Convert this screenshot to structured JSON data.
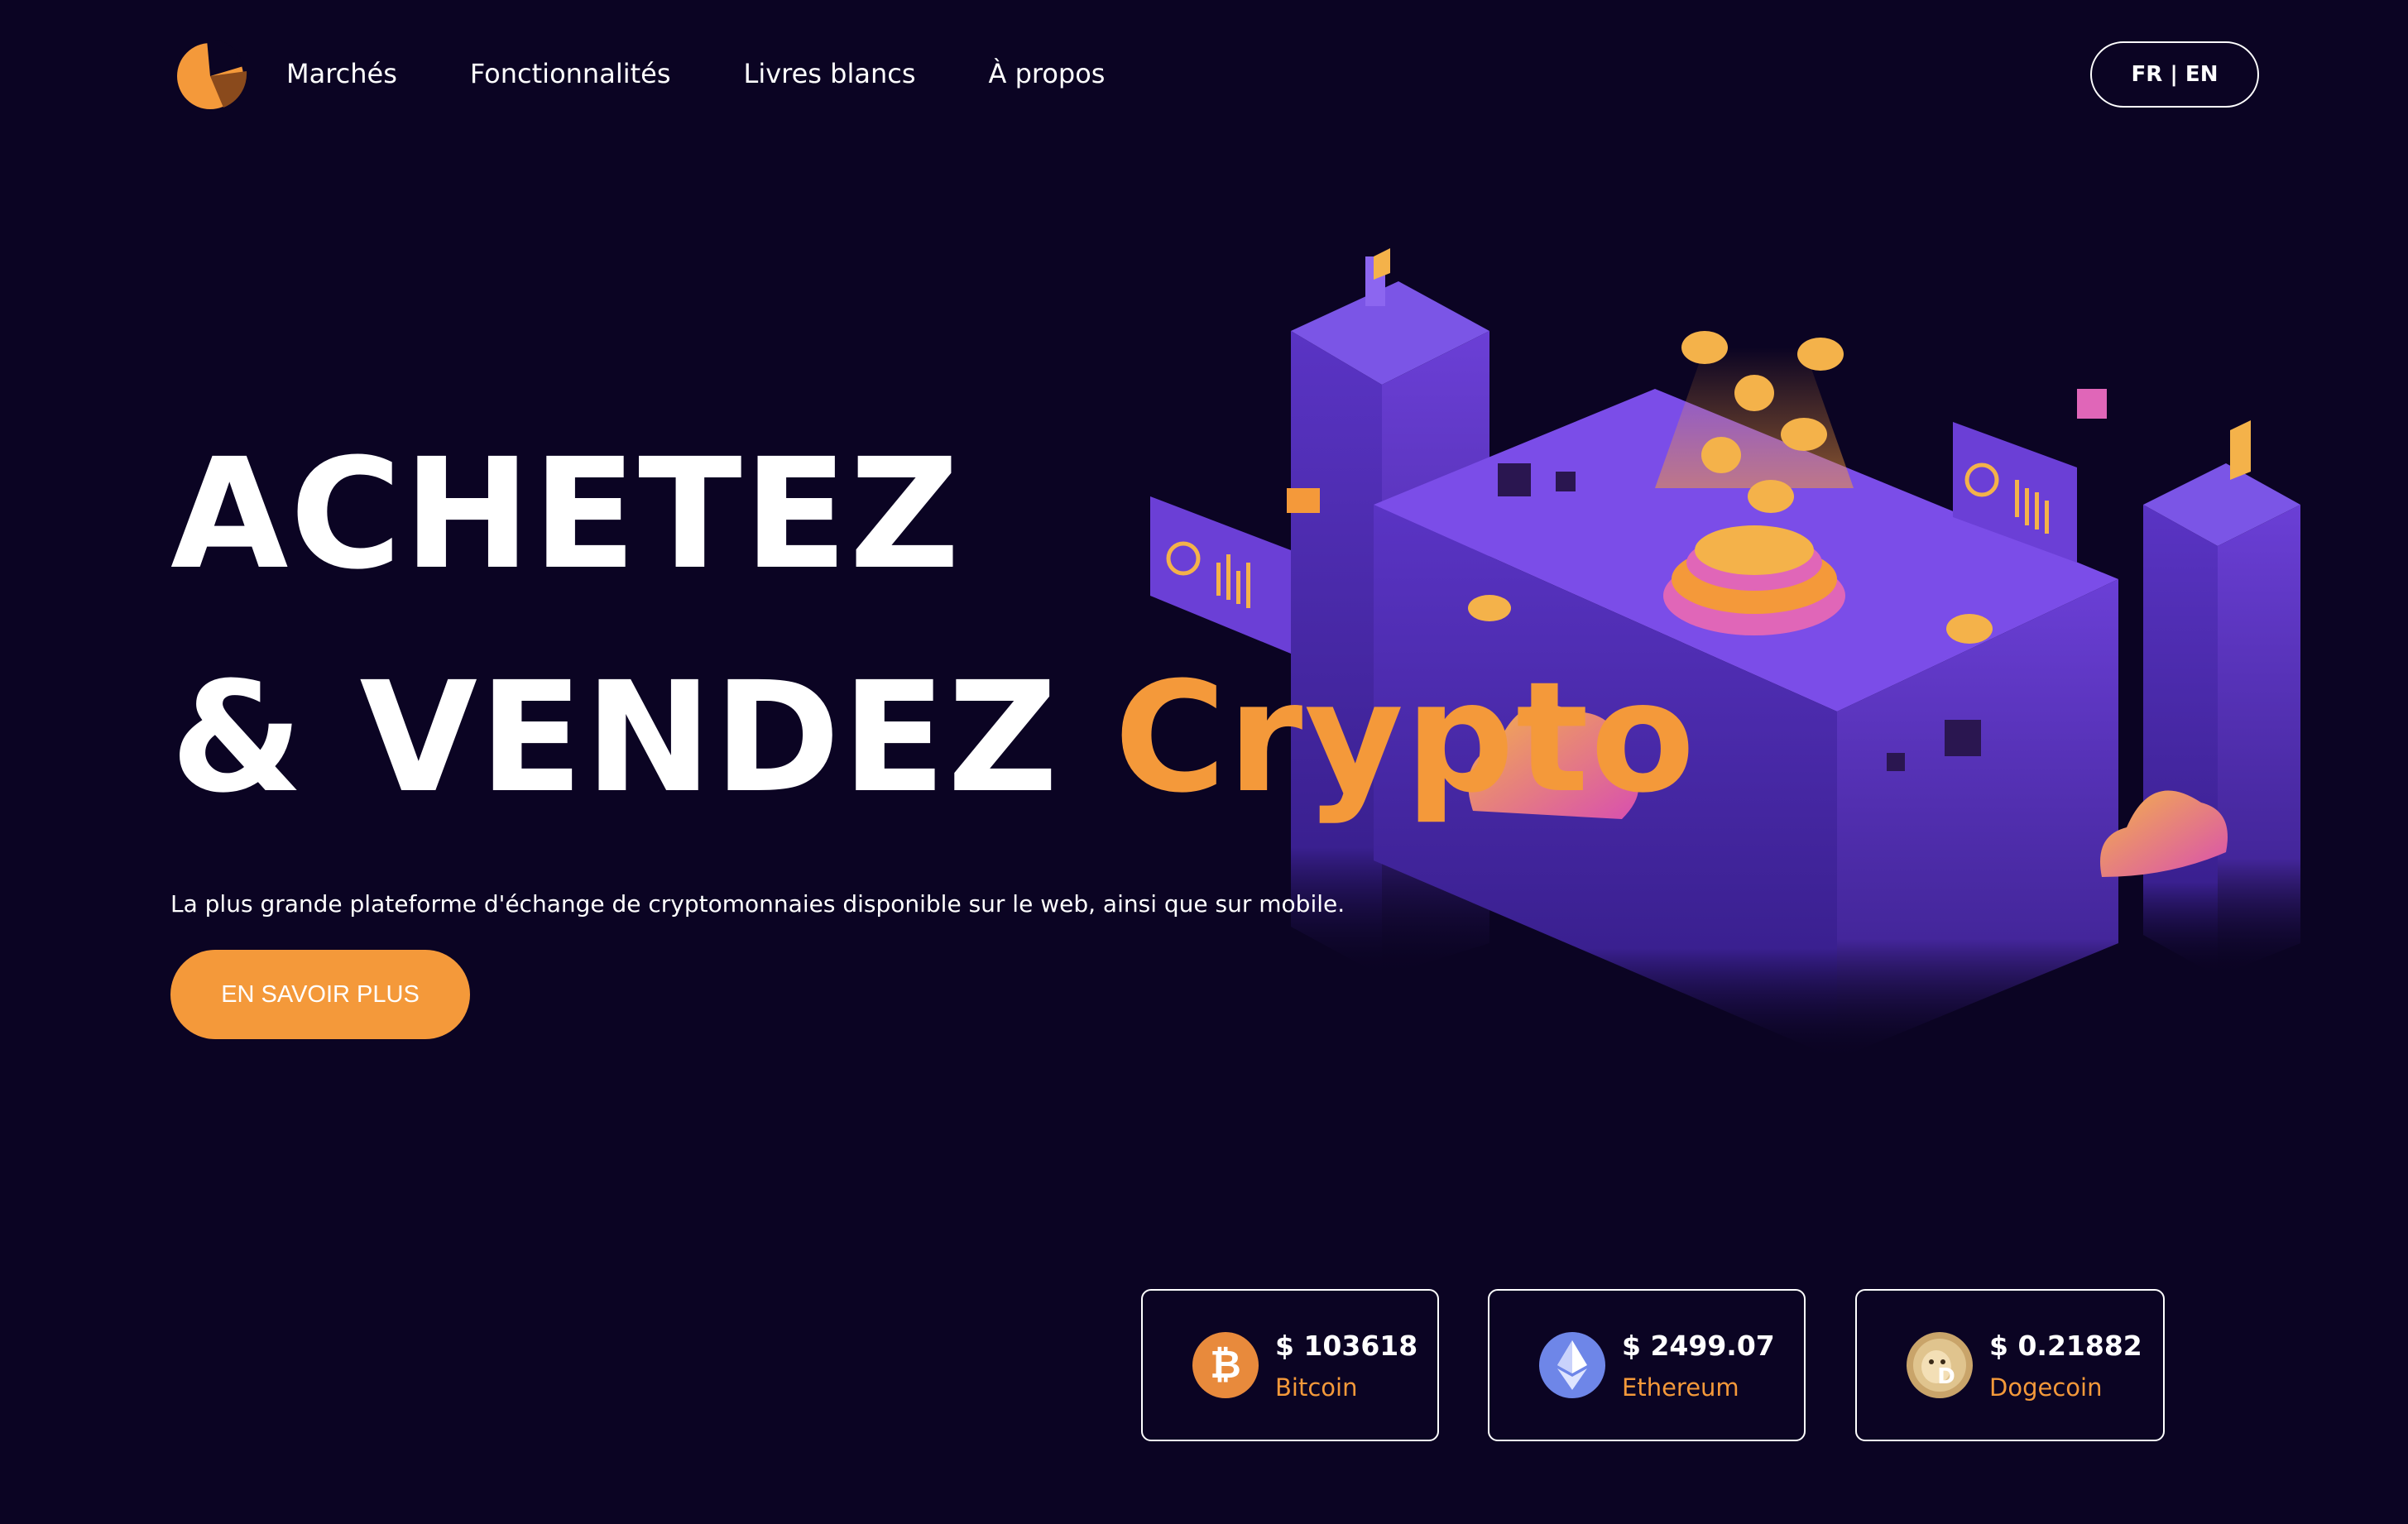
{
  "header": {
    "nav": [
      "Marchés",
      "Fonctionnalités",
      "Livres blancs",
      "À propos"
    ],
    "lang_toggle": "FR | EN"
  },
  "hero": {
    "line1": "ACHETEZ",
    "line2_prefix": "& VENDEZ ",
    "line2_accent": "Crypto",
    "subtitle": "La plus grande plateforme d'échange de cryptomonnaies disponible sur le web, ainsi que sur mobile.",
    "cta": "EN SAVOIR PLUS"
  },
  "prices": [
    {
      "price": "$ 103618",
      "name": "Bitcoin",
      "icon": "bitcoin-icon"
    },
    {
      "price": "$ 2499.07",
      "name": "Ethereum",
      "icon": "ethereum-icon"
    },
    {
      "price": "$ 0.21882",
      "name": "Dogecoin",
      "icon": "dogecoin-icon"
    }
  ],
  "colors": {
    "background": "#0b0423",
    "accent": "#f4993a",
    "purple": "#6b3fd6",
    "text": "#ffffff"
  }
}
